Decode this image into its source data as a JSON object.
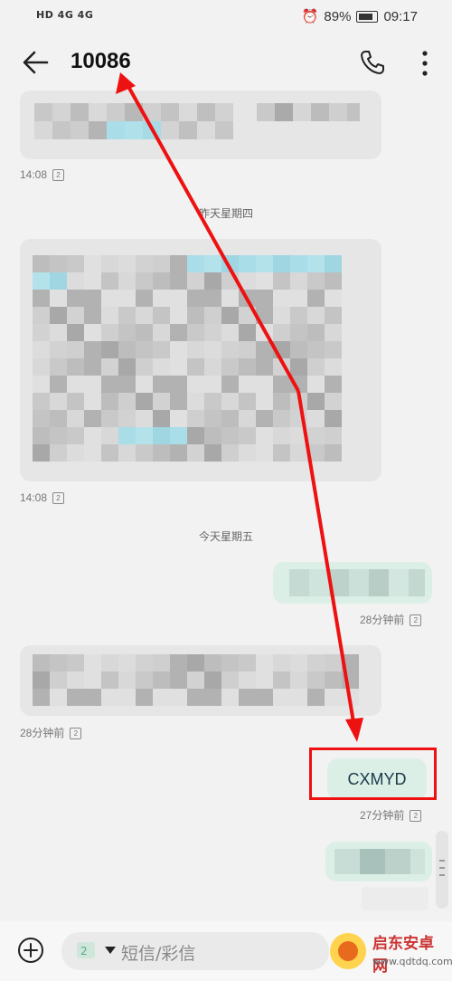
{
  "statusbar": {
    "left": "HD 4G 4G",
    "battery": "89%",
    "time": "09:17"
  },
  "header": {
    "title": "10086"
  },
  "messages": {
    "time1": "14:08",
    "date_thu": "昨天星期四",
    "time2": "14:08",
    "date_fri": "今天星期五",
    "time3": "28分钟前",
    "time4": "28分钟前",
    "sent_text": "CXMYD",
    "time5": "27分钟前",
    "sim_label": "2"
  },
  "composer": {
    "placeholder": "短信/彩信",
    "sim_number": "2"
  },
  "watermark": {
    "name": "启东安卓网",
    "url": "www.qdtdq.com"
  },
  "colors": {
    "annotation_red": "#e11",
    "sent_bubble": "#dcefe6",
    "recv_bubble": "#e6e6e6"
  }
}
